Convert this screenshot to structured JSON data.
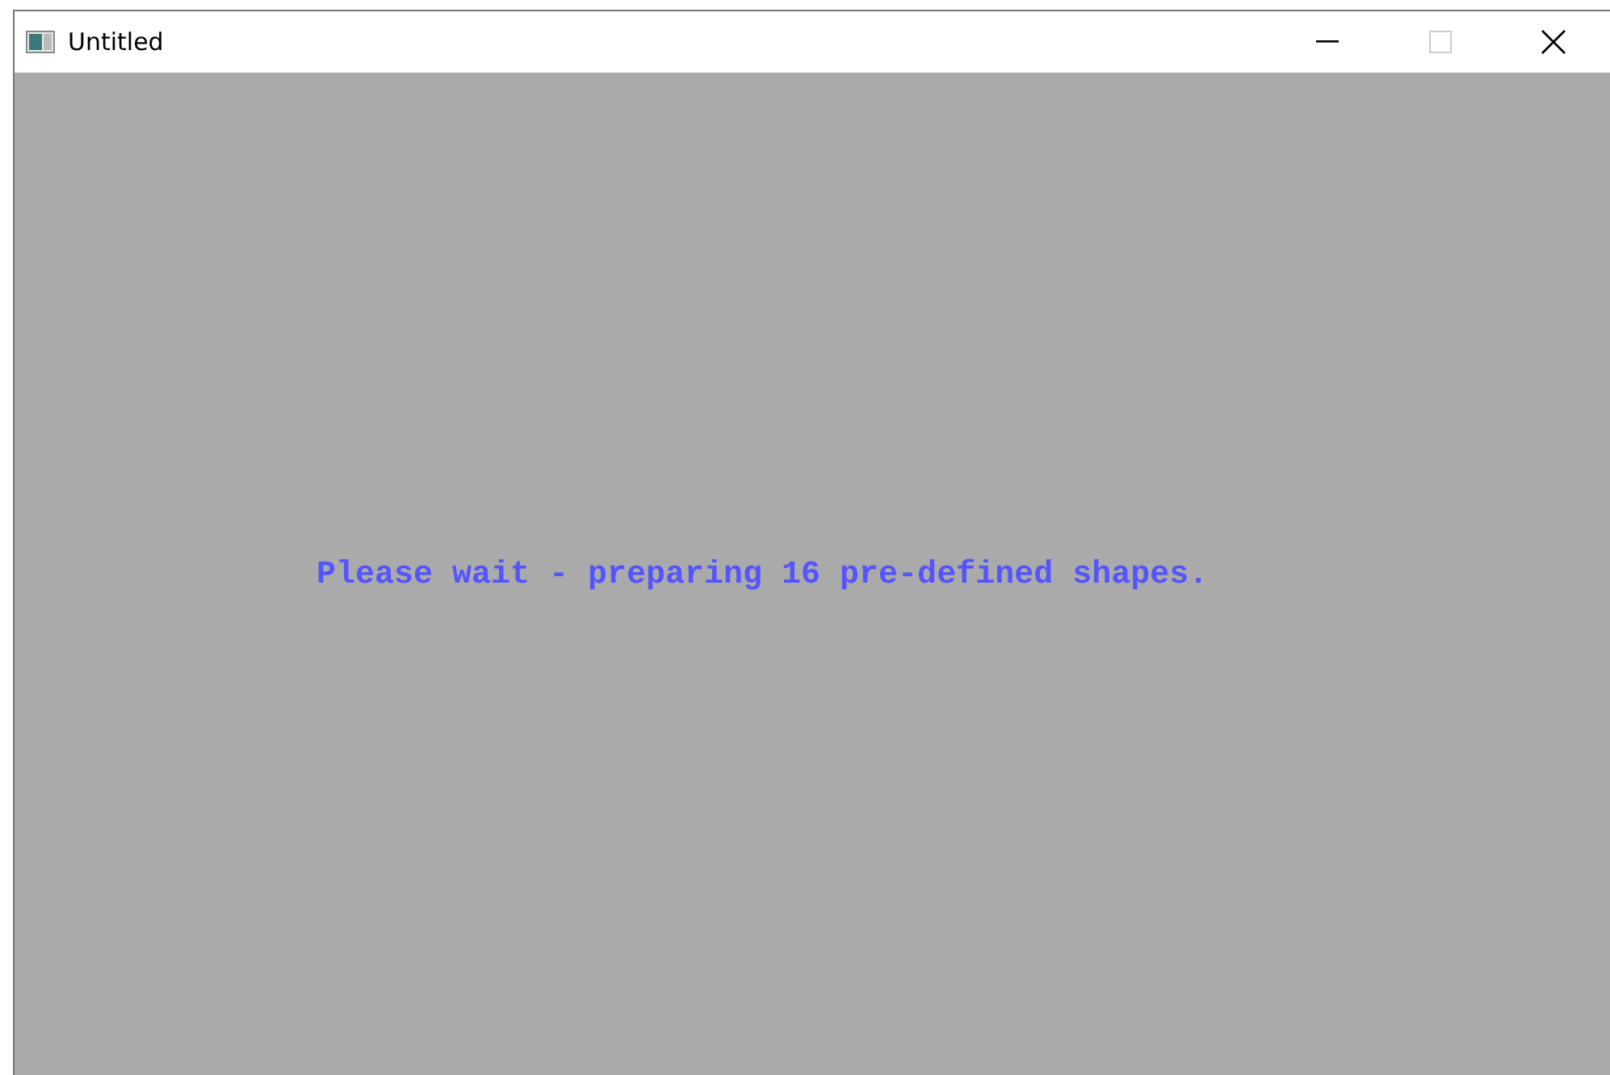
{
  "window": {
    "title": "Untitled",
    "controls": [
      {
        "kind": "minimize",
        "disabled": false
      },
      {
        "kind": "maximize",
        "disabled": true
      },
      {
        "kind": "close",
        "disabled": false
      }
    ]
  },
  "message": "Please wait - preparing 16 pre-defined shapes."
}
